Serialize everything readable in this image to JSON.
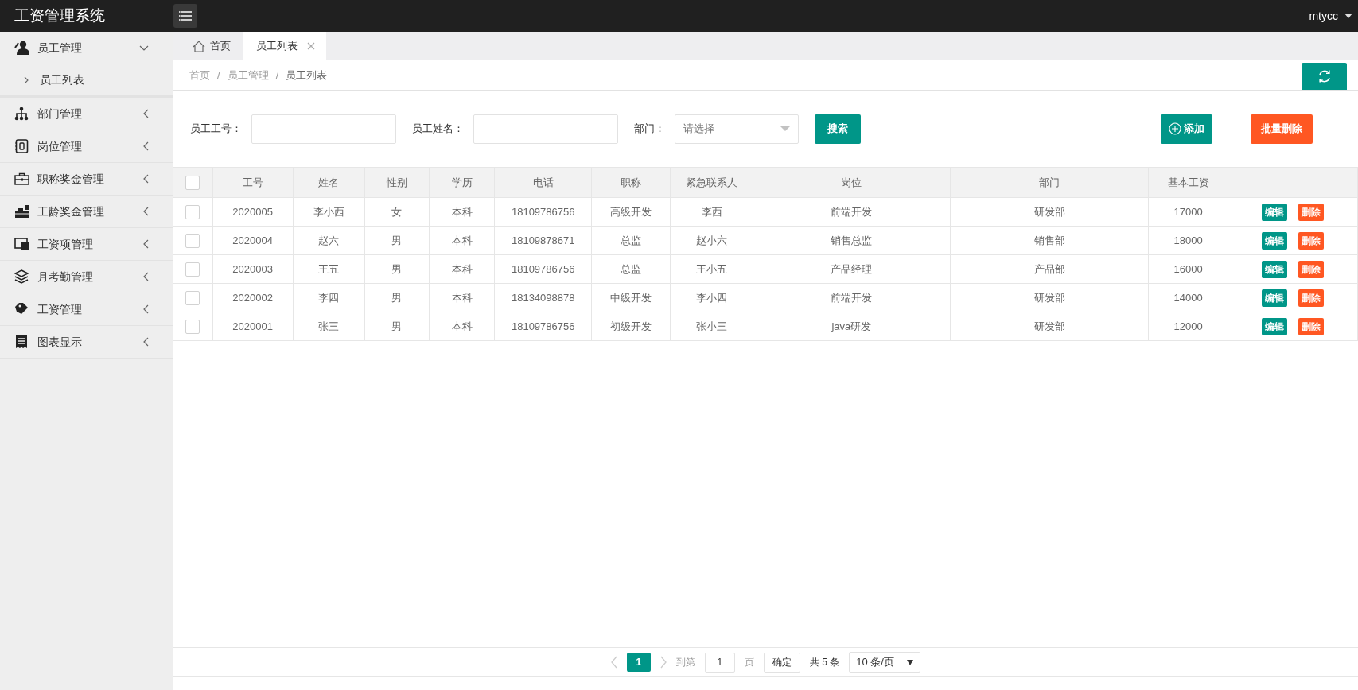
{
  "app": {
    "title": "工资管理系统",
    "user": "mtycc"
  },
  "sidebar": {
    "items": [
      {
        "label": "员工管理",
        "expanded": true,
        "children": [
          {
            "label": "员工列表"
          }
        ]
      },
      {
        "label": "部门管理",
        "expanded": false
      },
      {
        "label": "岗位管理",
        "expanded": false
      },
      {
        "label": "职称奖金管理",
        "expanded": false
      },
      {
        "label": "工龄奖金管理",
        "expanded": false
      },
      {
        "label": "工资项管理",
        "expanded": false
      },
      {
        "label": "月考勤管理",
        "expanded": false
      },
      {
        "label": "工资管理",
        "expanded": false
      },
      {
        "label": "图表显示",
        "expanded": false
      }
    ]
  },
  "tabs": [
    {
      "label": "首页",
      "kind": "home",
      "selected": false,
      "closable": false
    },
    {
      "label": "员工列表",
      "kind": "page",
      "selected": true,
      "closable": true
    }
  ],
  "breadcrumb": {
    "items": [
      "首页",
      "员工管理",
      "员工列表"
    ],
    "separators": [
      "/",
      "/"
    ]
  },
  "filters": [
    {
      "kind": "text",
      "label": "员工工号："
    },
    {
      "kind": "text",
      "label": "员工姓名："
    },
    {
      "kind": "select",
      "label": "部门：",
      "placeholder": "请选择"
    }
  ],
  "search_button": "搜索",
  "add_button": "添加",
  "batch_delete_button": "批量删除",
  "table": {
    "select_all_checked": false,
    "columns": [
      "工号",
      "姓名",
      "性别",
      "学历",
      "电话",
      "职称",
      "紧急联系人",
      "岗位",
      "部门",
      "基本工资"
    ],
    "rows": [
      {
        "checked": false,
        "cells": [
          "2020005",
          "李小西",
          "女",
          "本科",
          "18109786756",
          "高级开发",
          "李西",
          "前端开发",
          "研发部",
          "17000"
        ],
        "actions": [
          "编辑",
          "删除"
        ]
      },
      {
        "checked": false,
        "cells": [
          "2020004",
          "赵六",
          "男",
          "本科",
          "18109878671",
          "总监",
          "赵小六",
          "销售总监",
          "销售部",
          "18000"
        ],
        "actions": [
          "编辑",
          "删除"
        ]
      },
      {
        "checked": false,
        "cells": [
          "2020003",
          "王五",
          "男",
          "本科",
          "18109786756",
          "总监",
          "王小五",
          "产品经理",
          "产品部",
          "16000"
        ],
        "actions": [
          "编辑",
          "删除"
        ]
      },
      {
        "checked": false,
        "cells": [
          "2020002",
          "李四",
          "男",
          "本科",
          "18134098878",
          "中级开发",
          "李小四",
          "前端开发",
          "研发部",
          "14000"
        ],
        "actions": [
          "编辑",
          "删除"
        ]
      },
      {
        "checked": false,
        "cells": [
          "2020001",
          "张三",
          "男",
          "本科",
          "18109786756",
          "初级开发",
          "张小三",
          "java研发",
          "研发部",
          "12000"
        ],
        "actions": [
          "编辑",
          "删除"
        ]
      }
    ]
  },
  "pagination": {
    "pages": [
      {
        "label": "1",
        "selected": true
      }
    ],
    "goto_label": "到第",
    "page_input": "1",
    "page_unit": "页",
    "confirm": "确定",
    "total": "共 5 条",
    "page_size": "10 条/页"
  }
}
